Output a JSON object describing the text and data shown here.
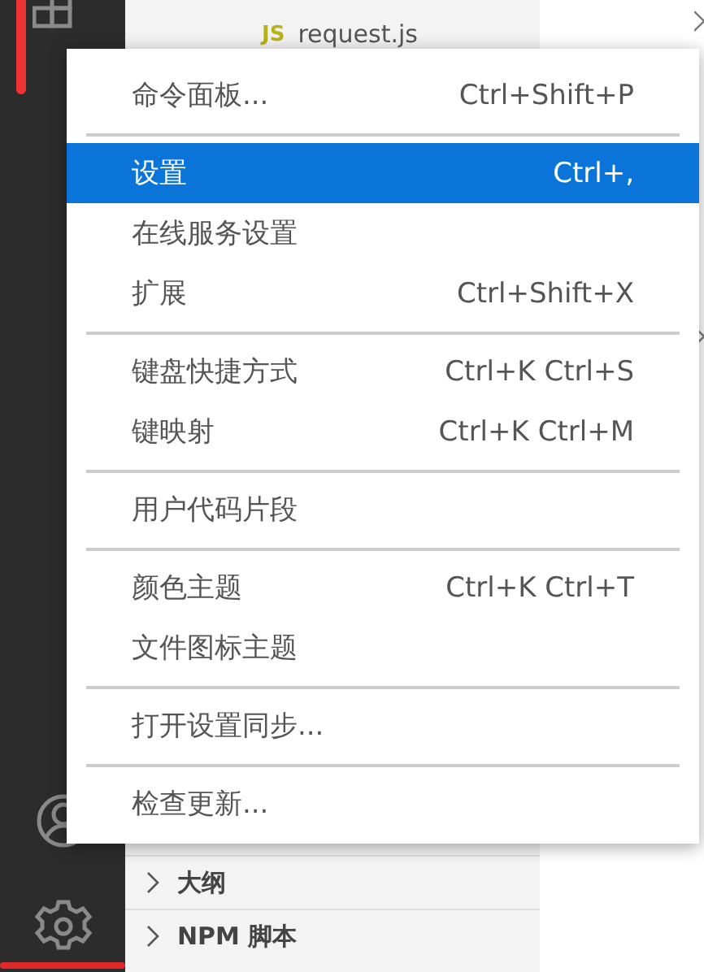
{
  "explorer": {
    "file": {
      "badge": "JS",
      "name": "request.js"
    }
  },
  "sections": [
    {
      "label": "大纲",
      "expanded": false
    },
    {
      "label": "NPM 脚本",
      "expanded": false
    }
  ],
  "menu": {
    "groups": [
      {
        "items": [
          {
            "label": "命令面板...",
            "shortcut": "Ctrl+Shift+P",
            "selected": false
          }
        ]
      },
      {
        "items": [
          {
            "label": "设置",
            "shortcut": "Ctrl+,",
            "selected": true
          },
          {
            "label": "在线服务设置",
            "selected": false
          },
          {
            "label": "扩展",
            "shortcut": "Ctrl+Shift+X",
            "selected": false
          }
        ]
      },
      {
        "items": [
          {
            "label": "键盘快捷方式",
            "shortcut": "Ctrl+K Ctrl+S",
            "selected": false
          },
          {
            "label": "键映射",
            "shortcut": "Ctrl+K Ctrl+M",
            "selected": false
          }
        ]
      },
      {
        "items": [
          {
            "label": "用户代码片段",
            "selected": false
          }
        ]
      },
      {
        "items": [
          {
            "label": "颜色主题",
            "shortcut": "Ctrl+K Ctrl+T",
            "selected": false
          },
          {
            "label": "文件图标主题",
            "selected": false
          }
        ]
      },
      {
        "items": [
          {
            "label": "打开设置同步...",
            "selected": false
          }
        ]
      },
      {
        "items": [
          {
            "label": "检查更新...",
            "selected": false
          }
        ]
      }
    ]
  }
}
